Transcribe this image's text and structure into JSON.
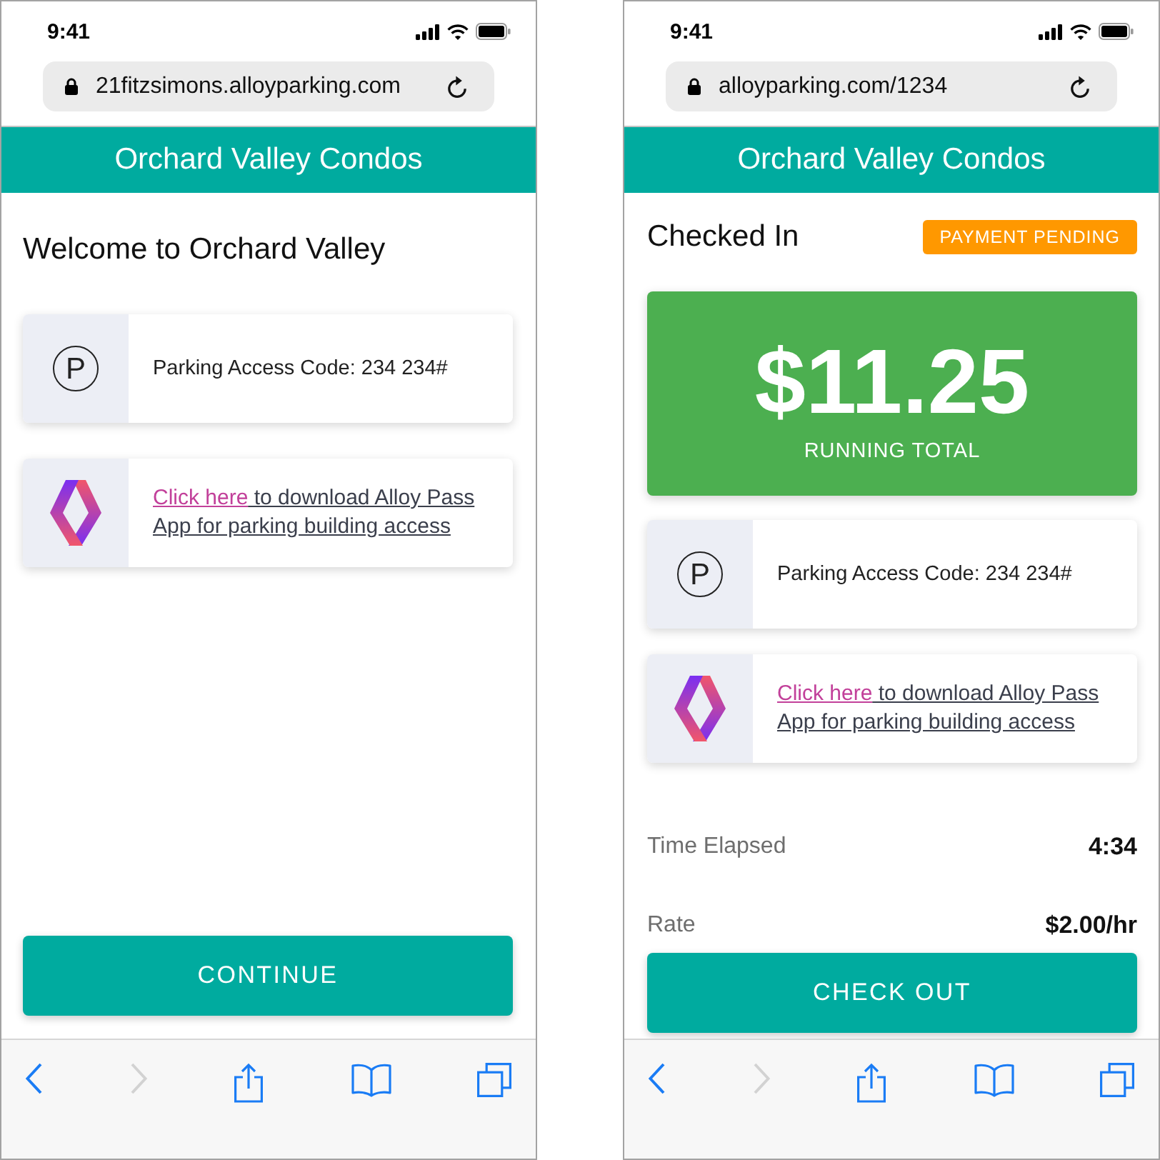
{
  "phones": [
    {
      "status_bar": {
        "time": "9:41"
      },
      "address_bar": {
        "url": "21fitzsimons.alloyparking.com"
      },
      "header": {
        "title": "Orchard Valley Condos"
      },
      "heading": "Welcome to Orchard Valley",
      "cards": [
        {
          "kind": "access_code",
          "icon": "P",
          "text": "Parking Access Code: 234 234#"
        },
        {
          "kind": "app_link",
          "link": "Click here",
          "text": "to download Alloy Pass App for parking building access"
        }
      ],
      "button": "CONTINUE",
      "toolbar": [
        {
          "kind": "back",
          "disabled": false
        },
        {
          "kind": "forward",
          "disabled": true
        },
        {
          "kind": "share",
          "disabled": false
        },
        {
          "kind": "bookmarks",
          "disabled": false
        },
        {
          "kind": "tabs",
          "disabled": false
        }
      ]
    },
    {
      "status_bar": {
        "time": "9:41"
      },
      "address_bar": {
        "url": "alloyparking.com/1234"
      },
      "header": {
        "title": "Orchard Valley Condos"
      },
      "heading": "Checked In",
      "badge": "PAYMENT PENDING",
      "total": {
        "amount": "$11.25",
        "label": "RUNNING TOTAL"
      },
      "cards": [
        {
          "kind": "access_code",
          "icon": "P",
          "text": "Parking Access Code: 234 234#"
        },
        {
          "kind": "app_link",
          "link": "Click here",
          "text": "to download Alloy Pass App for parking building access"
        }
      ],
      "details": [
        {
          "label": "Time Elapsed",
          "value": "4:34"
        },
        {
          "label": "Rate",
          "value": "$2.00/hr"
        }
      ],
      "button": "CHECK OUT",
      "toolbar": [
        {
          "kind": "back",
          "disabled": false
        },
        {
          "kind": "forward",
          "disabled": true
        },
        {
          "kind": "share",
          "disabled": false
        },
        {
          "kind": "bookmarks",
          "disabled": false
        },
        {
          "kind": "tabs",
          "disabled": false
        }
      ]
    }
  ]
}
